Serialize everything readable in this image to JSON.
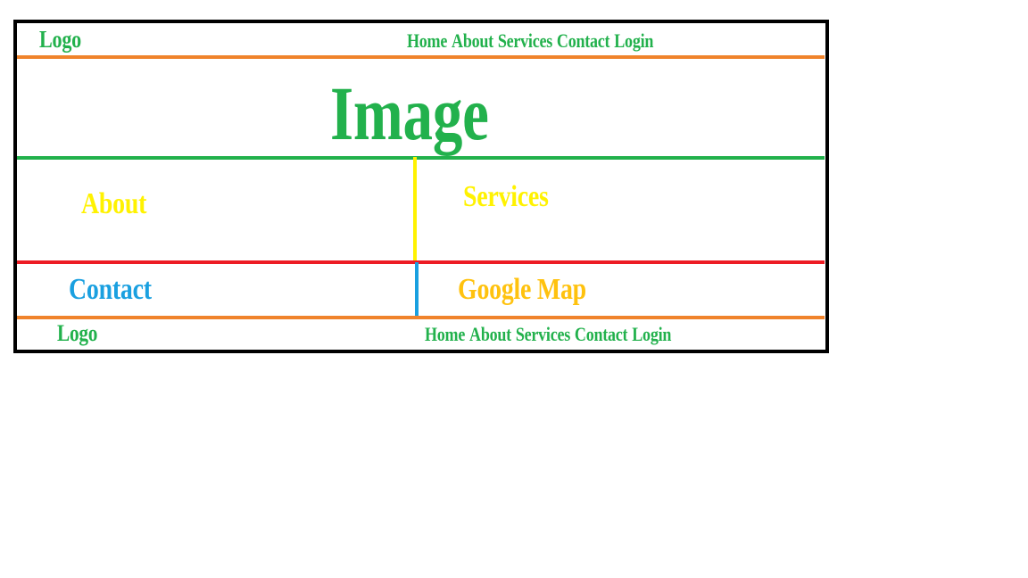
{
  "colors": {
    "frame": "#000000",
    "green": "#22b14c",
    "orange": "#f0832b",
    "yellow": "#fff200",
    "red": "#ed1c24",
    "blue": "#1aa0e0",
    "gold": "#ffc20e"
  },
  "header": {
    "logo": "Logo",
    "nav": [
      "Home",
      "About",
      "Services",
      "Contact",
      "Login"
    ]
  },
  "hero": {
    "label": "Image"
  },
  "sections": {
    "about": "About",
    "services": "Services",
    "contact": "Contact",
    "map": "Google Map"
  },
  "footer": {
    "logo": "Logo",
    "nav": [
      "Home",
      "About",
      "Services",
      "Contact",
      "Login"
    ]
  }
}
